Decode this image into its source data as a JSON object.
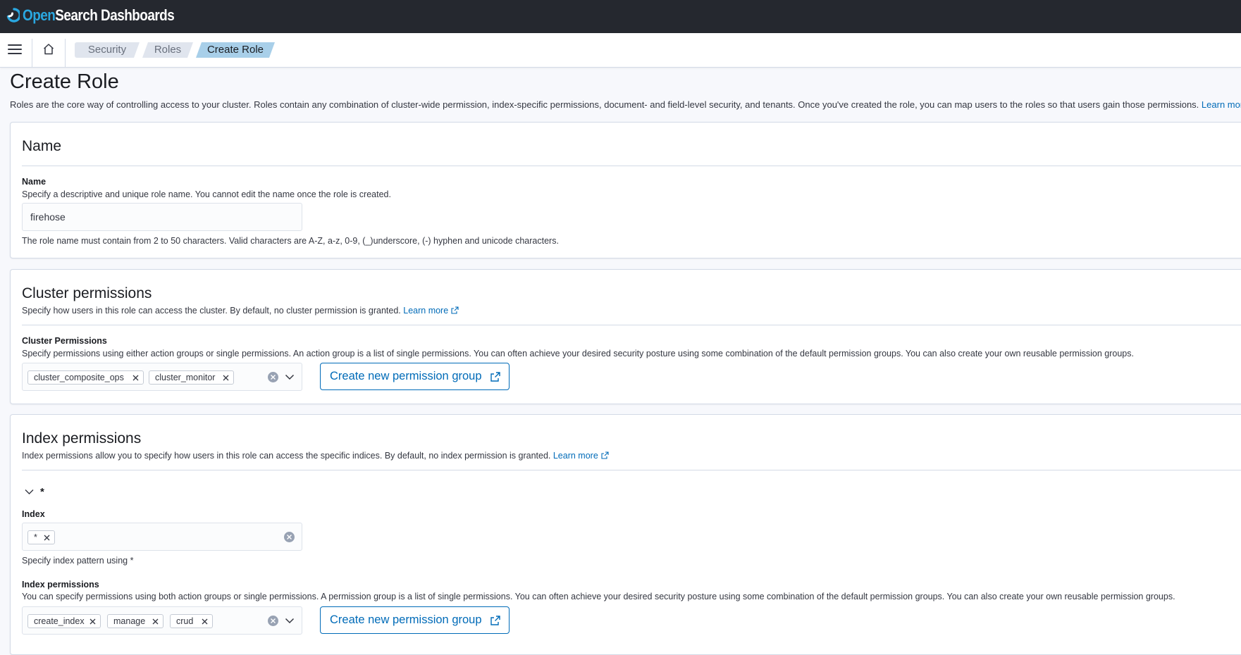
{
  "app": {
    "logo_part1": "Open",
    "logo_part2": "Search Dashboards"
  },
  "nav": {
    "menu_icon": "hamburger-menu-icon",
    "home_icon": "home-icon",
    "breadcrumbs": [
      "Security",
      "Roles",
      "Create Role"
    ]
  },
  "page": {
    "title": "Create Role",
    "description": "Roles are the core way of controlling access to your cluster. Roles contain any combination of cluster-wide permission, index-specific permissions, document- and field-level security, and tenants. Once you've created the role, you can map users to the roles so that users gain those permissions.",
    "learn_more": "Learn more"
  },
  "name_section": {
    "title": "Name",
    "label": "Name",
    "help": "Specify a descriptive and unique role name. You cannot edit the name once the role is created.",
    "value": "firehose",
    "constraint": "The role name must contain from 2 to 50 characters. Valid characters are A-Z, a-z, 0-9, (_)underscore, (-) hyphen and unicode characters."
  },
  "cluster_section": {
    "title": "Cluster permissions",
    "description": "Specify how users in this role can access the cluster. By default, no cluster permission is granted.",
    "learn_more": "Learn more",
    "label": "Cluster Permissions",
    "help": "Specify permissions using either action groups or single permissions. An action group is a list of single permissions. You can often achieve your desired security posture using some combination of the default permission groups. You can also create your own reusable permission groups.",
    "selected": [
      "cluster_composite_ops",
      "cluster_monitor"
    ],
    "create_button": "Create new permission group"
  },
  "index_section": {
    "title": "Index permissions",
    "description": "Index permissions allow you to specify how users in this role can access the specific indices. By default, no index permission is granted.",
    "learn_more": "Learn more",
    "group_title": "*",
    "index_label": "Index",
    "index_selected": [
      "*"
    ],
    "index_help": "Specify index pattern using *",
    "perm_label": "Index permissions",
    "perm_help": "You can specify permissions using both action groups or single permissions. A permission group is a list of single permissions. You can often achieve your desired security posture using some combination of the default permission groups. You can also create your own reusable permission groups.",
    "perm_selected": [
      "create_index",
      "manage",
      "crud"
    ],
    "create_button": "Create new permission group"
  },
  "colors": {
    "header_bg": "#25282f",
    "link": "#006bb8",
    "active_crumb": "#a8cfe9",
    "brand_open": "#2aa7e0"
  }
}
